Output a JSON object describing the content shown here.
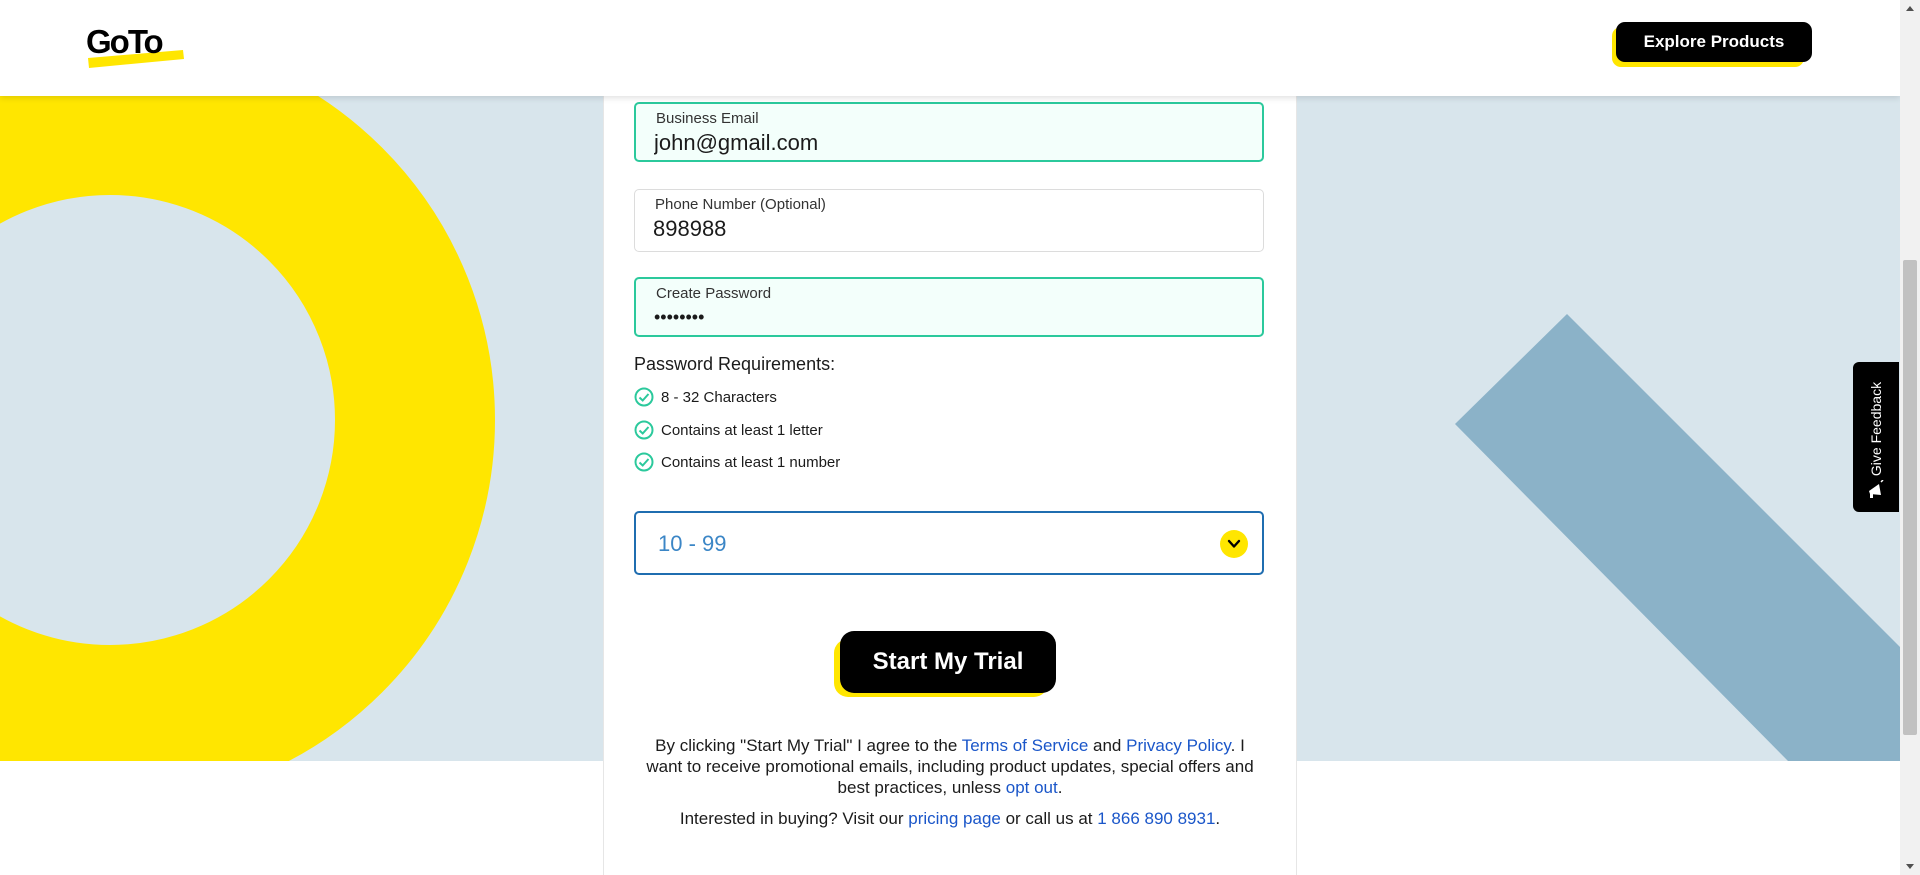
{
  "header": {
    "logo_text": "GoTo",
    "explore_label": "Explore Products"
  },
  "form": {
    "email": {
      "label": "Business Email",
      "value": "john@gmail.com"
    },
    "phone": {
      "label": "Phone Number (Optional)",
      "value": "898988"
    },
    "password": {
      "label": "Create Password",
      "value": "••••••••"
    },
    "requirements_title": "Password Requirements:",
    "requirements": [
      {
        "label": "8 - 32 Characters",
        "met": true
      },
      {
        "label": "Contains at least 1 letter",
        "met": true
      },
      {
        "label": "Contains at least 1 number",
        "met": true
      }
    ],
    "company_size": {
      "value": "10 - 99"
    },
    "submit_label": "Start My Trial"
  },
  "legal": {
    "prefix": "By clicking \"Start My Trial\" I agree to the ",
    "terms": "Terms of Service",
    "and": " and ",
    "privacy": "Privacy Policy",
    "middle": ". I want to receive promotional emails, including product updates, special offers and best practices, unless ",
    "opt_out": "opt out",
    "suffix": "."
  },
  "buying": {
    "prefix": "Interested in buying? Visit our ",
    "pricing": "pricing page",
    "middle": " or call us at ",
    "phone": "1 866 890 8931",
    "suffix": "."
  },
  "feedback": {
    "label": "Give Feedback",
    "icon": "megaphone-icon"
  },
  "colors": {
    "brand_yellow": "#ffe600",
    "valid_green": "#2bc99c",
    "link_blue": "#1a56c9",
    "background_blue": "#d8e5ec",
    "shape_blue": "#8bb2c8"
  }
}
